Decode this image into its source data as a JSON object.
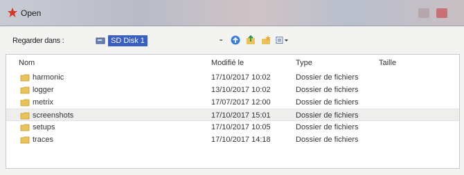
{
  "window": {
    "title": "Open"
  },
  "toolbar": {
    "look_in_label": "Regarder dans :",
    "location": "SD Disk 1"
  },
  "columns": {
    "name": "Nom",
    "modified": "Modifié le",
    "type": "Type",
    "size": "Taille"
  },
  "files": [
    {
      "name": "harmonic",
      "modified": "17/10/2017 10:02",
      "type": "Dossier de fichiers"
    },
    {
      "name": "logger",
      "modified": "13/10/2017 10:02",
      "type": "Dossier de fichiers"
    },
    {
      "name": "metrix",
      "modified": "17/07/2017 12:00",
      "type": "Dossier de fichiers"
    },
    {
      "name": "screenshots",
      "modified": "17/10/2017 15:01",
      "type": "Dossier de fichiers"
    },
    {
      "name": "setups",
      "modified": "17/10/2017 10:05",
      "type": "Dossier de fichiers"
    },
    {
      "name": "traces",
      "modified": "17/10/2017 14:18",
      "type": "Dossier de fichiers"
    }
  ],
  "colors": {
    "selection": "#3a5fbf",
    "folder": "#e8c25a",
    "title_icon": "#d23a2a"
  },
  "icons": {
    "title": "open-icon",
    "drive": "sd-drive-icon",
    "back": "back-icon",
    "up": "up-folder-icon",
    "new_folder": "new-folder-icon",
    "view": "view-menu-icon",
    "folder": "folder-icon"
  }
}
